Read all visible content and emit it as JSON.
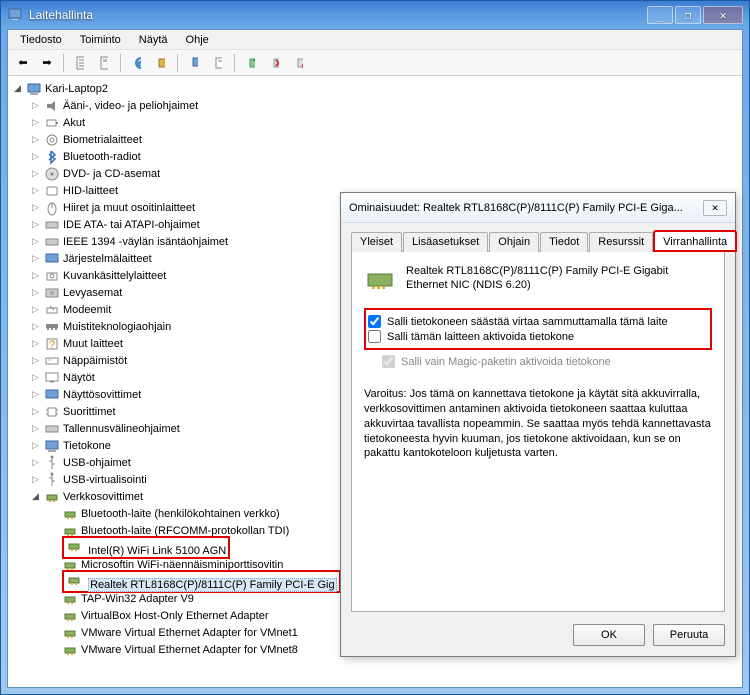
{
  "window": {
    "title": "Laitehallinta",
    "min_label": "_",
    "max_label": "❐",
    "close_label": "✕"
  },
  "menu": {
    "tiedosto": "Tiedosto",
    "toiminto": "Toiminto",
    "nayta": "Näytä",
    "ohje": "Ohje"
  },
  "tree": {
    "root": "Kari-Laptop2",
    "cat": {
      "audio": "Ääni-, video- ja peliohjaimet",
      "akut": "Akut",
      "biometria": "Biometrialaitteet",
      "bluetooth": "Bluetooth-radiot",
      "dvd": "DVD- ja CD-asemat",
      "hid": "HID-laitteet",
      "mice": "Hiiret ja muut osoitinlaitteet",
      "ide": "IDE ATA- tai ATAPI-ohjaimet",
      "ieee": "IEEE 1394 -väylän isäntäohjaimet",
      "system": "Järjestelmälaitteet",
      "imaging": "Kuvankäsittelylaitteet",
      "disk": "Levyasemat",
      "modem": "Modeemit",
      "memtech": "Muistiteknologiaohjain",
      "other": "Muut laitteet",
      "keyboards": "Näppäimistöt",
      "display": "Näytöt",
      "dispadapters": "Näyttösovittimet",
      "cpu": "Suorittimet",
      "storage": "Tallennusvälineohjaimet",
      "computer": "Tietokone",
      "usbctrl": "USB-ohjaimet",
      "usbvirt": "USB-virtualisointi",
      "net": "Verkkosovittimet"
    },
    "net_items": {
      "bt1": "Bluetooth-laite (henkilökohtainen verkko)",
      "bt2": "Bluetooth-laite (RFCOMM-protokollan TDI)",
      "wifi": "Intel(R) WiFi Link 5100 AGN",
      "ms": "Microsoftin WiFi-näennäisminiporttisovitin",
      "realtek": "Realtek RTL8168C(P)/8111C(P) Family PCI-E Gig",
      "tap": "TAP-Win32 Adapter V9",
      "vbox": "VirtualBox Host-Only Ethernet Adapter",
      "vm1": "VMware Virtual Ethernet Adapter for VMnet1",
      "vm8": "VMware Virtual Ethernet Adapter for VMnet8"
    }
  },
  "dialog": {
    "title": "Ominaisuudet: Realtek RTL8168C(P)/8111C(P) Family PCI-E Giga...",
    "tabs": {
      "yleiset": "Yleiset",
      "lisa": "Lisäasetukset",
      "ohjain": "Ohjain",
      "tiedot": "Tiedot",
      "resurssit": "Resurssit",
      "virran": "Virranhallinta"
    },
    "device_name": "Realtek RTL8168C(P)/8111C(P) Family PCI-E Gigabit Ethernet NIC (NDIS 6.20)",
    "chk1": "Salli tietokoneen säästää virtaa sammuttamalla tämä laite",
    "chk2": "Salli tämän laitteen aktivoida tietokone",
    "chk3": "Salli vain Magic-paketin aktivoida tietokone",
    "warning": "Varoitus: Jos tämä on kannettava tietokone ja käytät sitä akkuvirralla, verkkosovittimen antaminen aktivoida tietokoneen saattaa kuluttaa akkuvirtaa tavallista nopeammin. Se saattaa myös tehdä kannettavasta tietokoneesta hyvin kuuman, jos tietokone aktivoidaan, kun se on pakattu kantokoteloon kuljetusta varten.",
    "ok": "OK",
    "cancel": "Peruuta"
  }
}
